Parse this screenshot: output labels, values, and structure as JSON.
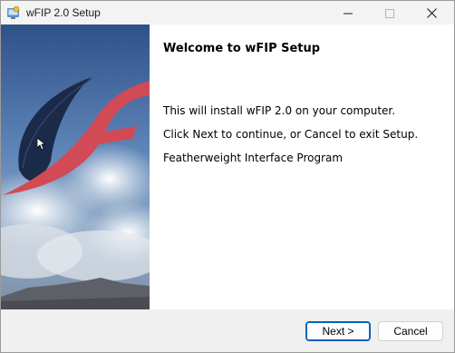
{
  "window": {
    "title": "wFIP 2.0 Setup"
  },
  "titlebar": {
    "icons": [
      "setup-app-icon",
      "minimize-icon",
      "maximize-icon",
      "close-icon"
    ]
  },
  "welcome": {
    "title": "Welcome to wFIP Setup",
    "line1": "This will install wFIP 2.0 on your computer.",
    "line2": "Click Next to continue, or Cancel to exit Setup.",
    "line3": "Featherweight Interface Program"
  },
  "buttons": {
    "next": "Next >",
    "cancel": "Cancel"
  },
  "colors": {
    "accent": "#005fb8",
    "feather_navy": "#1c2a4a",
    "feather_red": "#d24a55",
    "sky": "#3f6496"
  }
}
